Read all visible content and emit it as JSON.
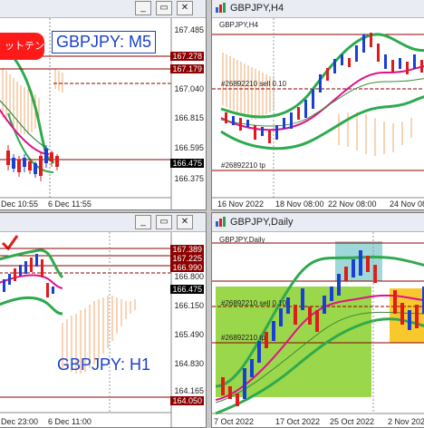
{
  "windows": {
    "m5": {
      "title": "",
      "symbol_label": "GBPJPY: M5",
      "badge_text": "ットテン",
      "prices": [
        "167.485",
        "167.278",
        "167.179",
        "167.040",
        "166.815",
        "166.595",
        "166.475",
        "166.375"
      ],
      "times": [
        "Dec 10:55",
        "6 Dec 11:55"
      ]
    },
    "h4": {
      "title": "GBPJPY,H4",
      "header_label": "GBPJPY,H4",
      "annotations": [
        "#26892210 sell 0.10",
        "#26892210 tp"
      ],
      "times": [
        "16 Nov 2022",
        "18 Nov 08:00",
        "22 Nov 08:00",
        "24 Nov 08"
      ]
    },
    "h1": {
      "title": "",
      "symbol_label": "GBPJPY: H1",
      "prices": [
        "167.389",
        "167.225",
        "166.990",
        "166.800",
        "166.475",
        "166.150",
        "165.490",
        "164.830",
        "164.165",
        "164.050"
      ],
      "times": [
        "Dec 23:00",
        "6 Dec 11:00"
      ]
    },
    "daily": {
      "title": "GBPJPY,Daily",
      "header_label": "GBPJPY,Daily",
      "annotations": [
        "#26892210 sell 0.10",
        "#26892210 tp"
      ],
      "times": [
        "7 Oct 2022",
        "17 Oct 2022",
        "25 Oct 2022",
        "2 Nov 2022"
      ]
    }
  },
  "buttons": {
    "minimize": "_",
    "restore": "▭",
    "close": "✕"
  },
  "colors": {
    "bull": "#1a3fd4",
    "bear": "#e01b1b",
    "band": "#2eaa4e",
    "ma": "#e0118c",
    "cloud_up": "#f0b070",
    "cloud_dn": "#9ad74a",
    "level": "#8b0000"
  }
}
